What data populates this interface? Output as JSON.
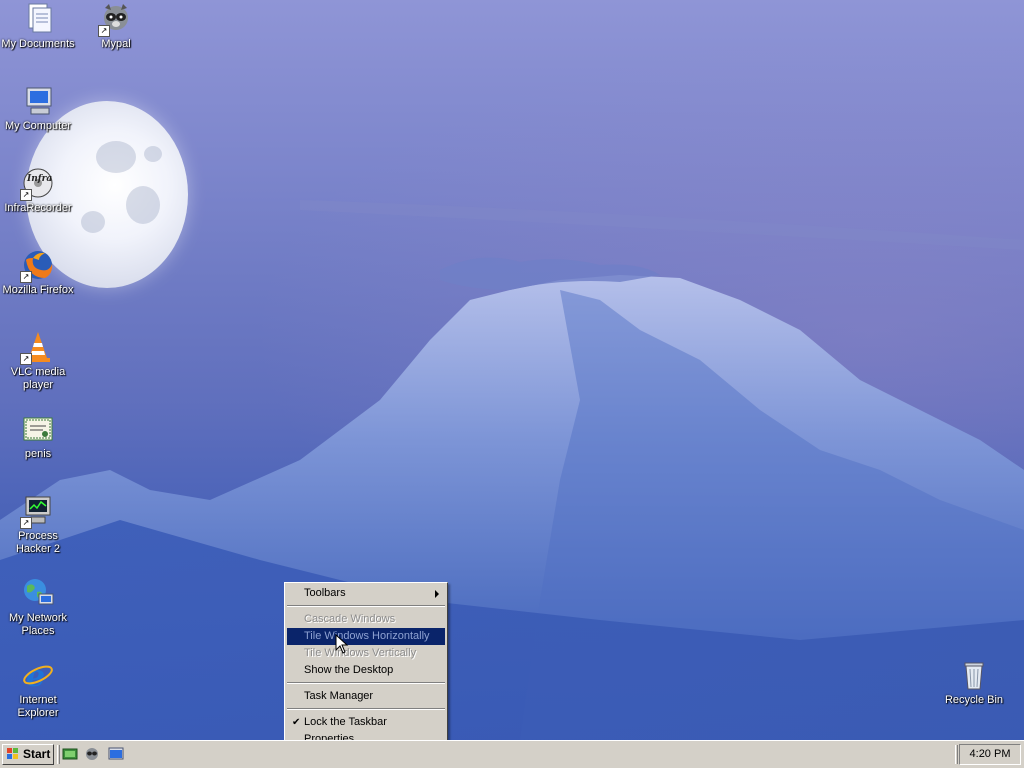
{
  "desktop": {
    "icons": [
      {
        "label": "My Documents",
        "icon": "documents-icon"
      },
      {
        "label": "Mypal",
        "icon": "raccoon-icon"
      },
      {
        "label": "My Computer",
        "icon": "computer-icon"
      },
      {
        "label": "InfraRecorder",
        "icon": "infrarecorder-icon"
      },
      {
        "label": "Mozilla Firefox",
        "icon": "firefox-icon"
      },
      {
        "label": "VLC media player",
        "icon": "vlc-cone-icon"
      },
      {
        "label": "penis",
        "icon": "certificate-icon"
      },
      {
        "label": "Process Hacker 2",
        "icon": "process-hacker-icon"
      },
      {
        "label": "My Network Places",
        "icon": "network-globe-icon"
      },
      {
        "label": "Internet Explorer",
        "icon": "ie-icon"
      },
      {
        "label": "Recycle Bin",
        "icon": "recycle-bin-icon"
      }
    ]
  },
  "context_menu": {
    "items": [
      {
        "label": "Toolbars",
        "state": "normal",
        "submenu": true
      },
      {
        "label": "Cascade Windows",
        "state": "disabled"
      },
      {
        "label": "Tile Windows Horizontally",
        "state": "disabled",
        "highlighted": true
      },
      {
        "label": "Tile Windows Vertically",
        "state": "disabled"
      },
      {
        "label": "Show the Desktop",
        "state": "normal"
      },
      {
        "label": "Task Manager",
        "state": "normal"
      },
      {
        "label": "Lock the Taskbar",
        "state": "normal",
        "checked": true
      },
      {
        "label": "Properties",
        "state": "normal"
      }
    ]
  },
  "taskbar": {
    "start_label": "Start",
    "quick_launch": [
      "show-desktop-icon",
      "mypal-icon",
      "desktop-window-icon"
    ],
    "clock": "4:20 PM"
  },
  "colors": {
    "menu_bg": "#d4d0c8",
    "highlight": "#0a246a",
    "desktop_label": "#ffffff"
  }
}
